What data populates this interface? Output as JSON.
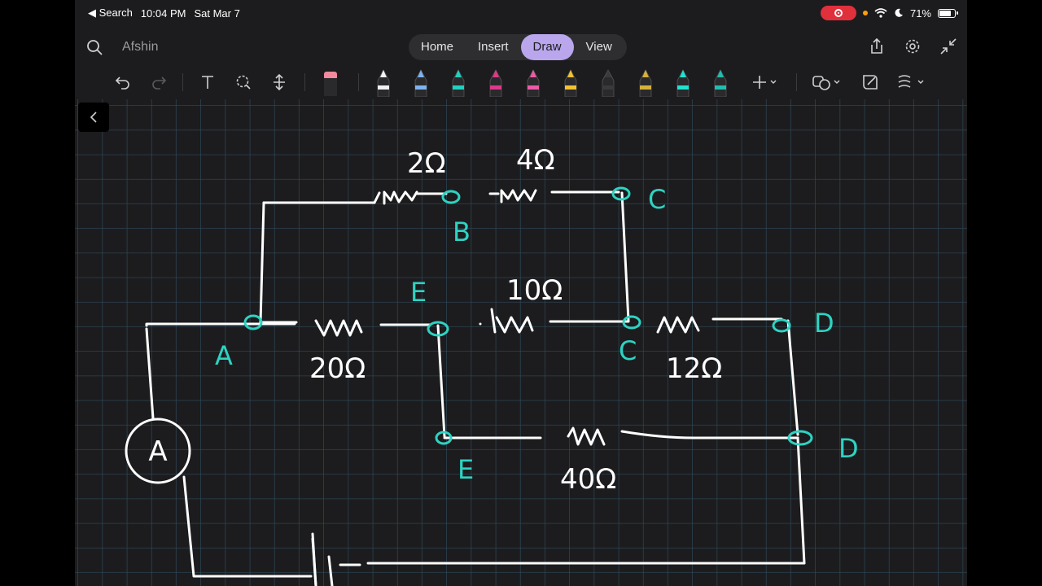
{
  "status": {
    "back_label": "◀ Search",
    "time": "10:04 PM",
    "date": "Sat Mar 7",
    "battery": "71%"
  },
  "header": {
    "doc_title": "Afshin",
    "tabs": [
      "Home",
      "Insert",
      "Draw",
      "View"
    ],
    "active_tab": "Draw"
  },
  "toolbar": {
    "pens": [
      {
        "name": "pen-white",
        "color": "#f2f2f2"
      },
      {
        "name": "pen-blue",
        "color": "#7fb3f0"
      },
      {
        "name": "pen-teal",
        "color": "#1fd1c0"
      },
      {
        "name": "pen-magenta",
        "color": "#e0388a"
      },
      {
        "name": "pen-pink",
        "color": "#ee5aa8"
      },
      {
        "name": "pen-yellow",
        "color": "#f3c232"
      },
      {
        "name": "pen-dark",
        "color": "#3a3a3a"
      },
      {
        "name": "pen-gold",
        "color": "#d6b03a"
      },
      {
        "name": "highlighter-teal",
        "color": "#1ee3d0"
      },
      {
        "name": "pen-teal-2",
        "color": "#1fbfb0"
      }
    ]
  },
  "drawing": {
    "labels": {
      "r_top_left": "2Ω",
      "r_top_right": "4Ω",
      "r_mid": "10Ω",
      "r_left": "20Ω",
      "r_right": "12Ω",
      "r_bottom": "40Ω",
      "node_b": "B",
      "node_c_top": "C",
      "node_e_top": "E",
      "node_a": "A",
      "node_c_mid": "C",
      "node_d_top": "D",
      "node_e_bottom": "E",
      "node_d_bottom": "D",
      "ammeter": "A"
    },
    "ink_white": "#ffffff",
    "ink_teal": "#2ed3c2"
  }
}
